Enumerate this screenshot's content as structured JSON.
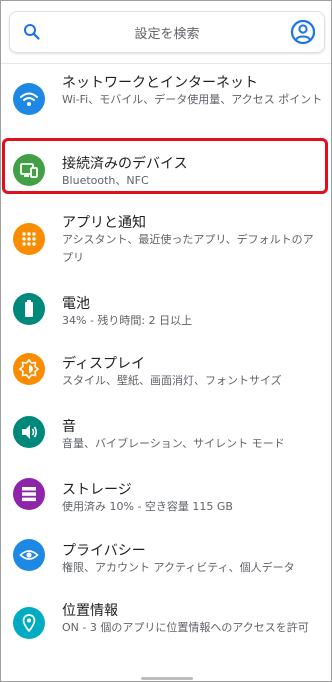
{
  "search": {
    "placeholder": "設定を検索"
  },
  "colors": {
    "network": "#1e88e5",
    "devices": "#43a047",
    "apps": "#fb8c00",
    "battery": "#00897b",
    "display": "#fb8c00",
    "sound": "#00897b",
    "storage": "#8e24aa",
    "privacy": "#1e88e5",
    "location": "#00acc1",
    "highlight": "#e00f1a"
  },
  "settings": [
    {
      "title": "ネットワークとインターネット",
      "subtitle": "Wi-Fi、モバイル、データ使用量、アクセス ポイント",
      "icon": "wifi-icon"
    },
    {
      "title": "接続済みのデバイス",
      "subtitle": "Bluetooth、NFC",
      "icon": "connected-devices-icon"
    },
    {
      "title": "アプリと通知",
      "subtitle": "アシスタント、最近使ったアプリ、デフォルトのアプリ",
      "icon": "apps-grid-icon"
    },
    {
      "title": "電池",
      "subtitle": "34% - 残り時間: 2 日以上",
      "icon": "battery-icon"
    },
    {
      "title": "ディスプレイ",
      "subtitle": "スタイル、壁紙、画面消灯、フォントサイズ",
      "icon": "brightness-icon"
    },
    {
      "title": "音",
      "subtitle": "音量、バイブレーション、サイレント モード",
      "icon": "volume-icon"
    },
    {
      "title": "ストレージ",
      "subtitle": "使用済み 10% - 空き容量 115 GB",
      "icon": "storage-icon"
    },
    {
      "title": "プライバシー",
      "subtitle": "権限、アカウント アクティビティ、個人データ",
      "icon": "privacy-eye-icon"
    },
    {
      "title": "位置情報",
      "subtitle": "ON - 3 個のアプリに位置情報へのアクセスを許可",
      "icon": "location-pin-icon"
    }
  ]
}
